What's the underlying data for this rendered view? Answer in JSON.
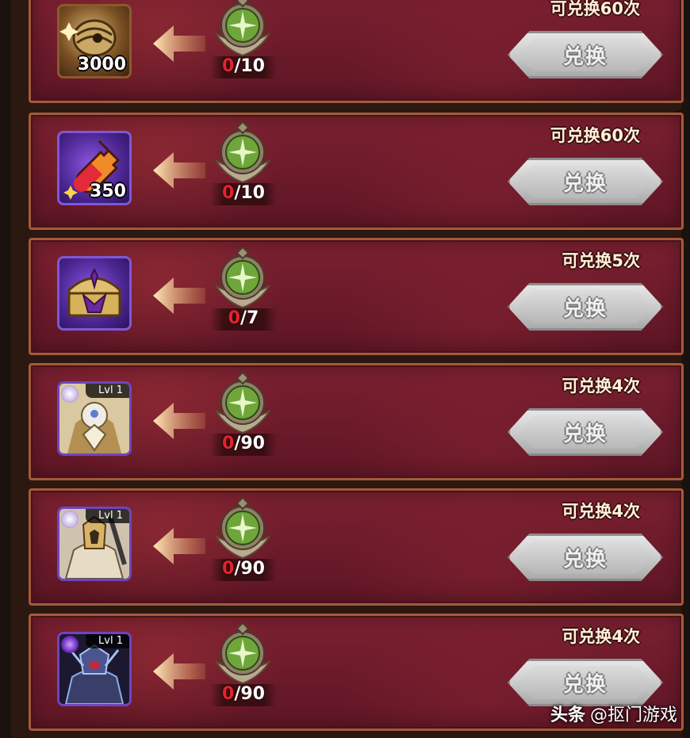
{
  "rows": [
    {
      "item_icon": "scroll-icon",
      "item_qty": "3000",
      "cost_have": "0",
      "cost_need": "/10",
      "limit": "可兑换60次",
      "button": "兑换"
    },
    {
      "item_icon": "potion-icon",
      "item_qty": "350",
      "cost_have": "0",
      "cost_need": "/10",
      "limit": "可兑换60次",
      "button": "兑换"
    },
    {
      "item_icon": "chest-icon",
      "item_qty": "",
      "cost_have": "0",
      "cost_need": "/7",
      "limit": "可兑换5次",
      "button": "兑换"
    },
    {
      "item_icon": "hero-portrait-light-icon",
      "item_level": "Lvl 1",
      "cost_have": "0",
      "cost_need": "/90",
      "limit": "可兑换4次",
      "button": "兑换"
    },
    {
      "item_icon": "hero-portrait-knight-icon",
      "item_level": "Lvl 1",
      "cost_have": "0",
      "cost_need": "/90",
      "limit": "可兑换4次",
      "button": "兑换"
    },
    {
      "item_icon": "hero-portrait-dark-icon",
      "item_level": "Lvl 1",
      "cost_have": "0",
      "cost_need": "/90",
      "limit": "可兑换4次",
      "button": "兑换"
    }
  ],
  "currency_icon": "green-emblem-icon",
  "watermark": {
    "prefix": "头条",
    "text": "@抠门游戏"
  },
  "colors": {
    "panel": "#6b1a2a",
    "border": "#a45a3b",
    "zero_count": "#e3242b",
    "button": "#c9c9c9"
  }
}
